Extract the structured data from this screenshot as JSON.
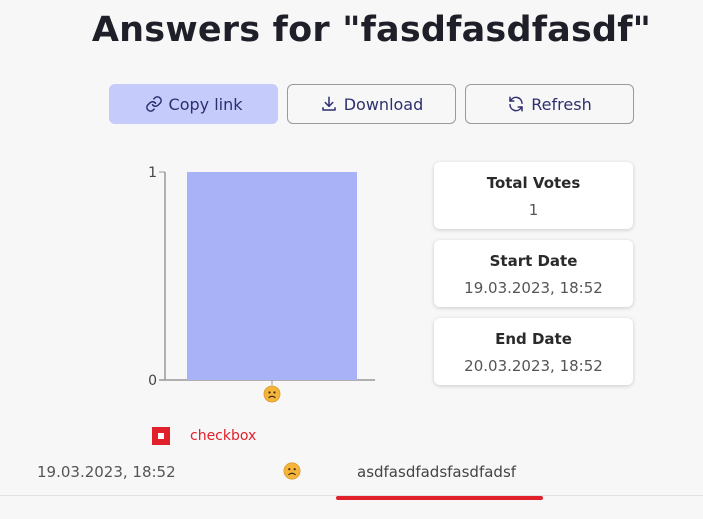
{
  "page": {
    "title": "Answers for \"fasdfasdfasdf\""
  },
  "toolbar": {
    "copy_label": "Copy link",
    "download_label": "Download",
    "refresh_label": "Refresh"
  },
  "stats": {
    "total_votes_label": "Total Votes",
    "total_votes_value": "1",
    "start_date_label": "Start Date",
    "start_date_value": "19.03.2023, 18:52",
    "end_date_label": "End Date",
    "end_date_value": "20.03.2023, 18:52"
  },
  "legend": {
    "label": "checkbox",
    "color": "#e0202a"
  },
  "chart_data": {
    "type": "bar",
    "categories": [
      "worried-face-emoji"
    ],
    "values": [
      1
    ],
    "ylim": [
      0,
      1
    ],
    "yticks": [
      "0",
      "1"
    ],
    "bar_color": "#a9b2f7",
    "grid": false
  },
  "answers": [
    {
      "date": "19.03.2023, 18:52",
      "emoji": "worried-face-emoji",
      "text": "asdfasdfadsfasdfadsf"
    }
  ],
  "colors": {
    "accent": "#c5cbfb",
    "highlight": "#e0202a",
    "bar": "#a9b2f7"
  }
}
